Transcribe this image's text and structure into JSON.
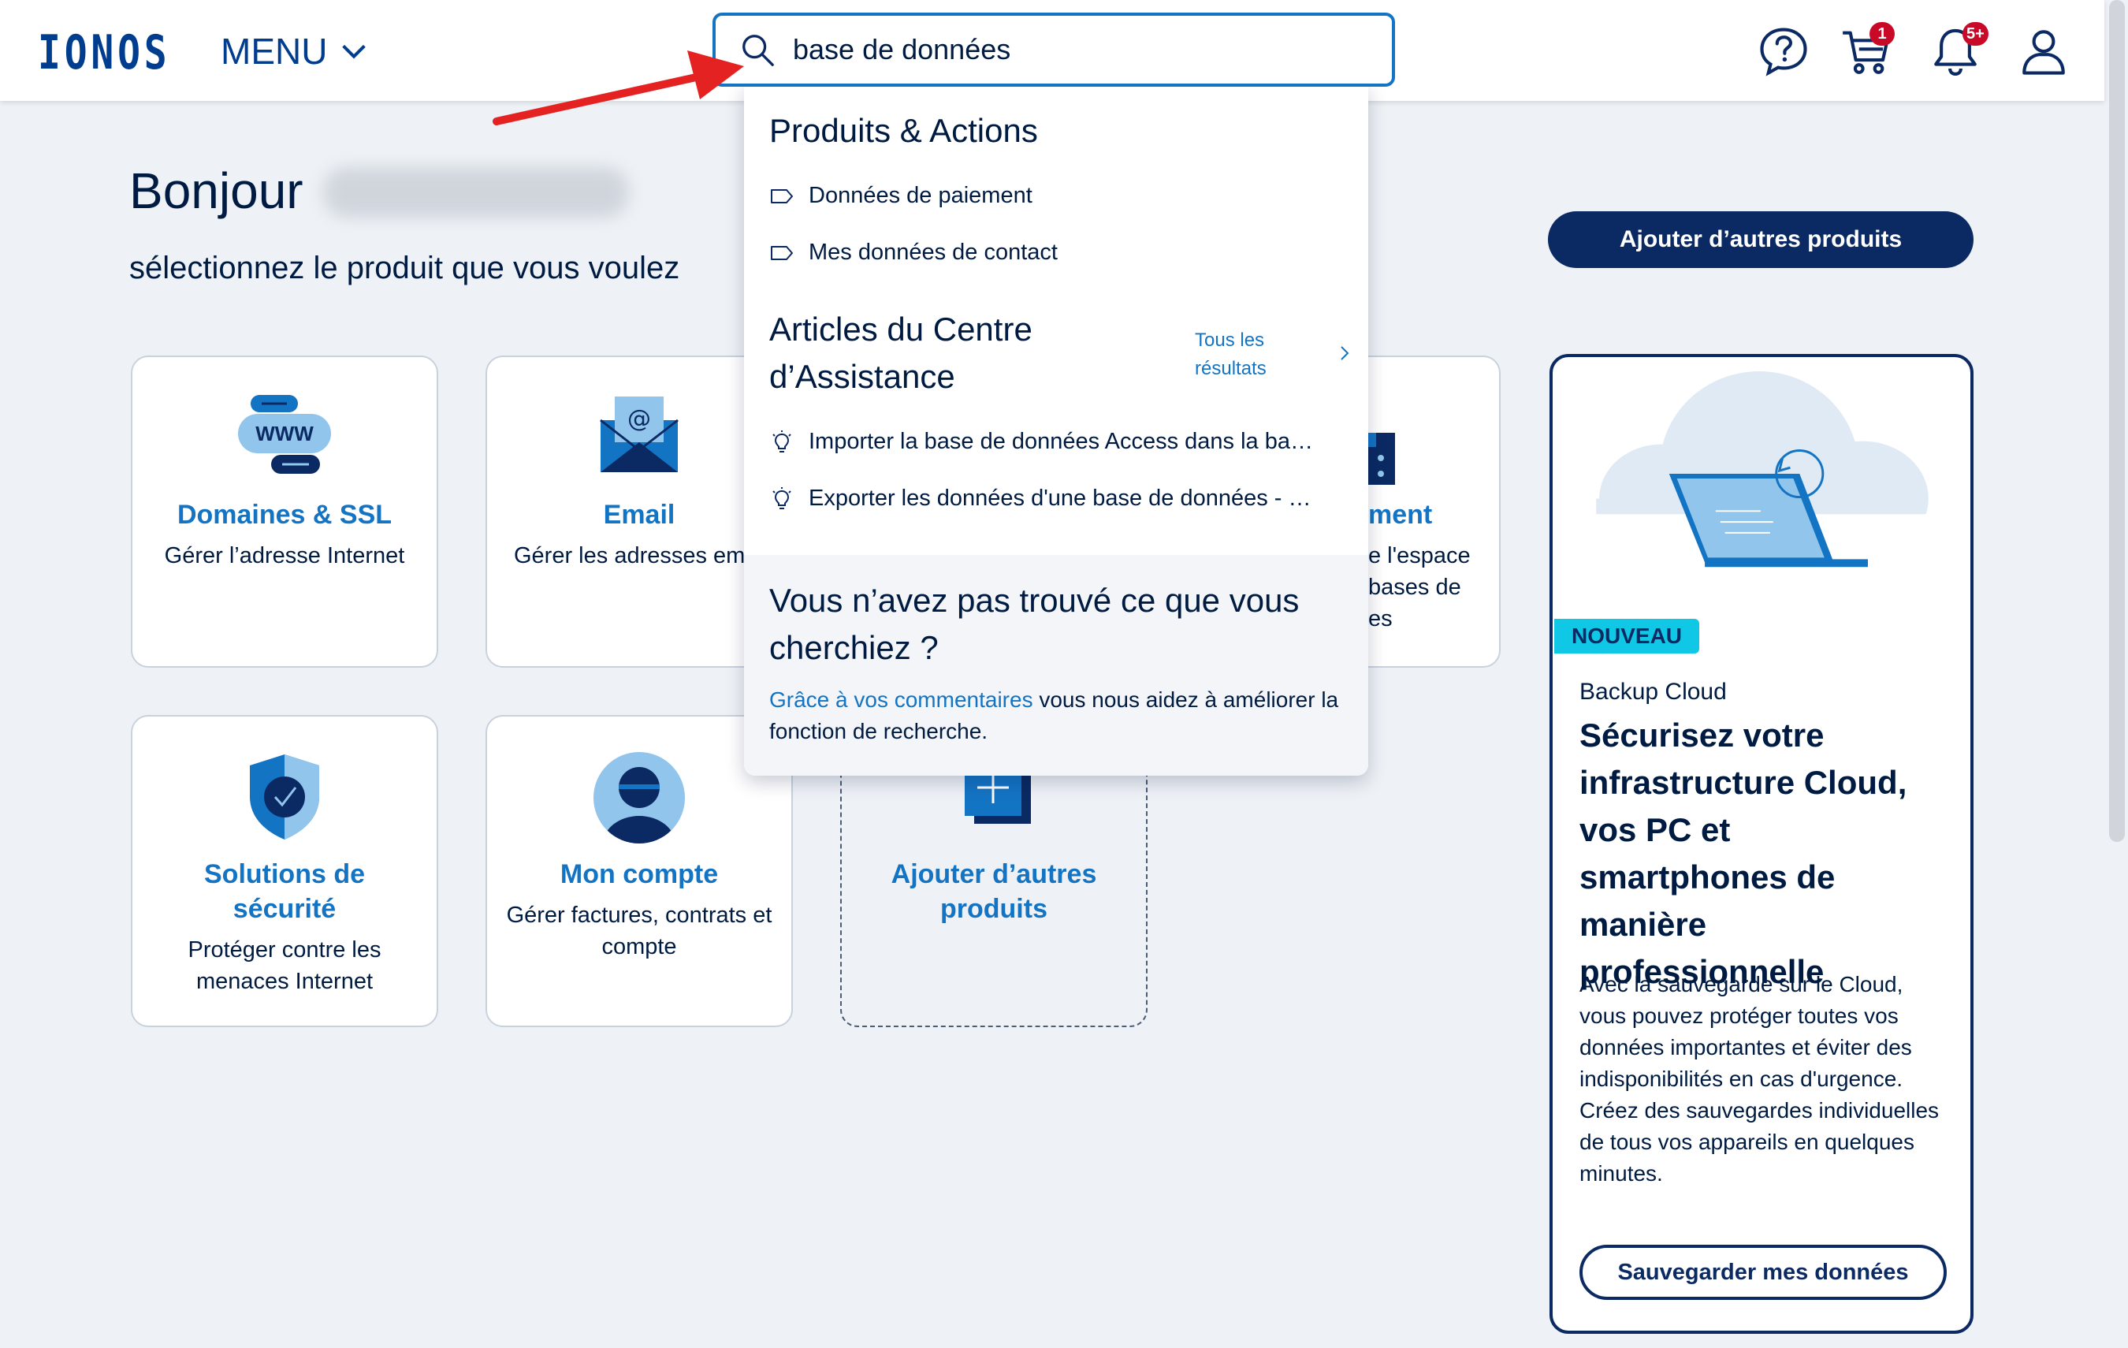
{
  "header": {
    "logo": "IONOS",
    "menu_label": "MENU",
    "search_value": "base de données",
    "cart_badge": "1",
    "notif_badge": "5+"
  },
  "main": {
    "greeting": "Bonjour",
    "subtitle": "sélectionnez le produit que vous voulez",
    "add_products_button": "Ajouter d’autres produits",
    "cards": [
      {
        "title": "Domaines & SSL",
        "desc": "Gérer l’adresse Internet"
      },
      {
        "title": "Email",
        "desc": "Gérer les adresses em"
      },
      {
        "title": "ment",
        "desc": "e l'espace\nbases de\nes"
      },
      {
        "title": "Solutions de sécurité",
        "desc": "Protéger contre les menaces Internet"
      },
      {
        "title": "Mon compte",
        "desc": "Gérer factures, contrats et compte"
      },
      {
        "title": "Ajouter d’autres produits",
        "desc": ""
      }
    ],
    "www_label": "WWW"
  },
  "dropdown": {
    "section1_title": "Produits & Actions",
    "actions": [
      "Données de paiement",
      "Mes données de contact"
    ],
    "section2_title": "Articles du Centre d’Assistance",
    "all_results": "Tous les résultats",
    "articles": [
      "Importer la base de données Access dans la ba…",
      "Exporter les données d'une base de données - …"
    ],
    "footer_title": "Vous n’avez pas trouvé ce que vous cherchiez ?",
    "footer_link": "Grâce à vos commentaires",
    "footer_text": " vous nous aidez à améliorer la fonction de recherche."
  },
  "promo": {
    "badge": "NOUVEAU",
    "kicker": "Backup Cloud",
    "title": "Sécurisez votre infrastructure Cloud, vos PC et smartphones de manière professionnelle",
    "desc": "Avec la sauvegarde sur le Cloud, vous pouvez protéger toutes vos données importantes et éviter des indisponibilités en cas d'urgence. Créez des sauvegardes individuelles de tous vos appareils en quelques minutes.",
    "button": "Sauvegarder mes données"
  },
  "colors": {
    "brand": "#003d8f",
    "accent": "#1474c4",
    "dark": "#0b2a63",
    "badge": "#c80a28",
    "arrow": "#e52222"
  }
}
